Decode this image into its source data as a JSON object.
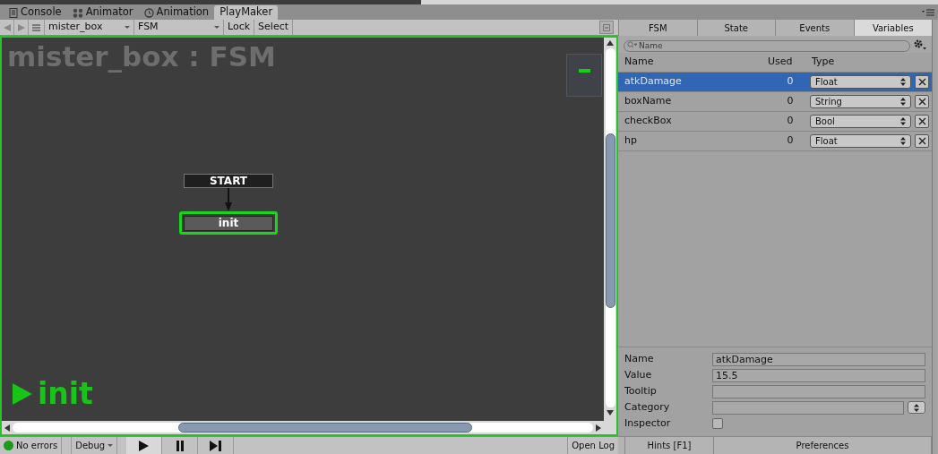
{
  "tabs": [
    {
      "label": "Console",
      "selected": false
    },
    {
      "label": "Animator",
      "selected": false
    },
    {
      "label": "Animation",
      "selected": false
    },
    {
      "label": "PlayMaker",
      "selected": true
    }
  ],
  "toolbar": {
    "owner": "mister_box",
    "fsm": "FSM",
    "buttons": [
      "Lock",
      "Select"
    ]
  },
  "canvas": {
    "title": "mister_box : FSM",
    "start_label": "START",
    "states": [
      {
        "name": "init",
        "selected": true
      }
    ],
    "active_state": "init"
  },
  "panel_tabs": [
    {
      "label": "FSM",
      "selected": false
    },
    {
      "label": "State",
      "selected": false
    },
    {
      "label": "Events",
      "selected": false
    },
    {
      "label": "Variables",
      "selected": true
    }
  ],
  "search": {
    "placeholder": "Name"
  },
  "columns": [
    "Name",
    "Used",
    "Type"
  ],
  "variables": [
    {
      "name": "atkDamage",
      "used": "0",
      "type": "Float",
      "selected": true
    },
    {
      "name": "boxName",
      "used": "0",
      "type": "String",
      "selected": false
    },
    {
      "name": "checkBox",
      "used": "0",
      "type": "Bool",
      "selected": false
    },
    {
      "name": "hp",
      "used": "0",
      "type": "Float",
      "selected": false
    }
  ],
  "details": {
    "name_label": "Name",
    "name_value": "atkDamage",
    "value_label": "Value",
    "value": "15.5",
    "tooltip_label": "Tooltip",
    "category_label": "Category",
    "inspector_label": "Inspector",
    "inspector_checked": false
  },
  "panel_footer": [
    "Hints [F1]",
    "Preferences"
  ],
  "status_bar": {
    "errors": "No errors",
    "debug": "Debug",
    "open_log": "Open Log"
  }
}
